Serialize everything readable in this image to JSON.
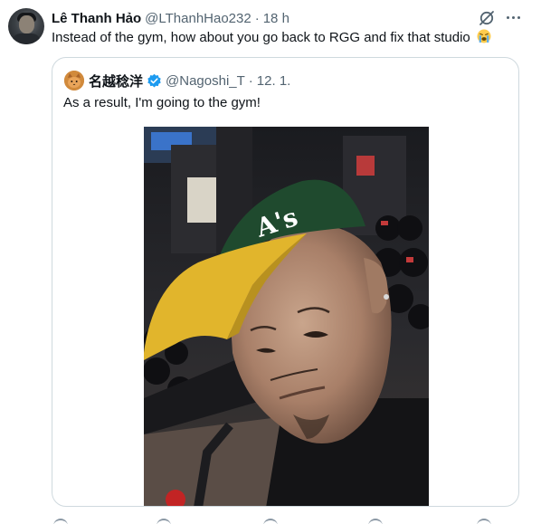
{
  "tweet": {
    "author_name": "Lê Thanh Hảo",
    "author_handle": "@LThanhHao232",
    "separator": "·",
    "time": "18 h",
    "text": "Instead of the gym, how about you go back to RGG and fix that studio",
    "emoji_name": "loudly-crying-face",
    "icons": {
      "grok": "grok-icon",
      "more": "more-options-icon"
    }
  },
  "quote": {
    "author_name": "名越稔洋",
    "author_handle": "@Nagoshi_T",
    "separator": "·",
    "date": "12. 1.",
    "verified": true,
    "text": "As a result, I'm going to the gym!",
    "photo_subject": "selfie-in-gym-with-green-and-yellow-cap"
  },
  "colors": {
    "text_primary": "#0f1419",
    "text_secondary": "#536471",
    "border": "#cfd9de",
    "verified_blue": "#1d9bf0",
    "cap_green": "#1f4a2e",
    "cap_yellow": "#e1b52c"
  }
}
